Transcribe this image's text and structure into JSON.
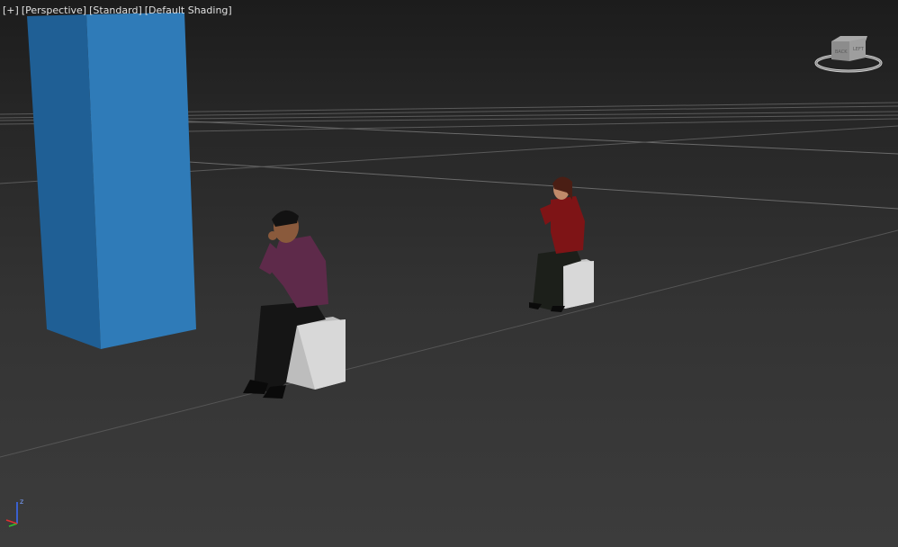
{
  "viewport": {
    "labels": {
      "plus": "[+]",
      "view": "[Perspective]",
      "preset": "[Standard]",
      "shading": "[Default Shading]"
    },
    "axis": {
      "z_label": "z"
    },
    "colors": {
      "background": "#333333",
      "box": "#2f7bb8",
      "box_side": "#1f5f95",
      "stool": "#d6d6d6",
      "man_shirt": "#5e2a4a",
      "woman_shirt": "#7e1416",
      "pants": "#151515"
    }
  }
}
